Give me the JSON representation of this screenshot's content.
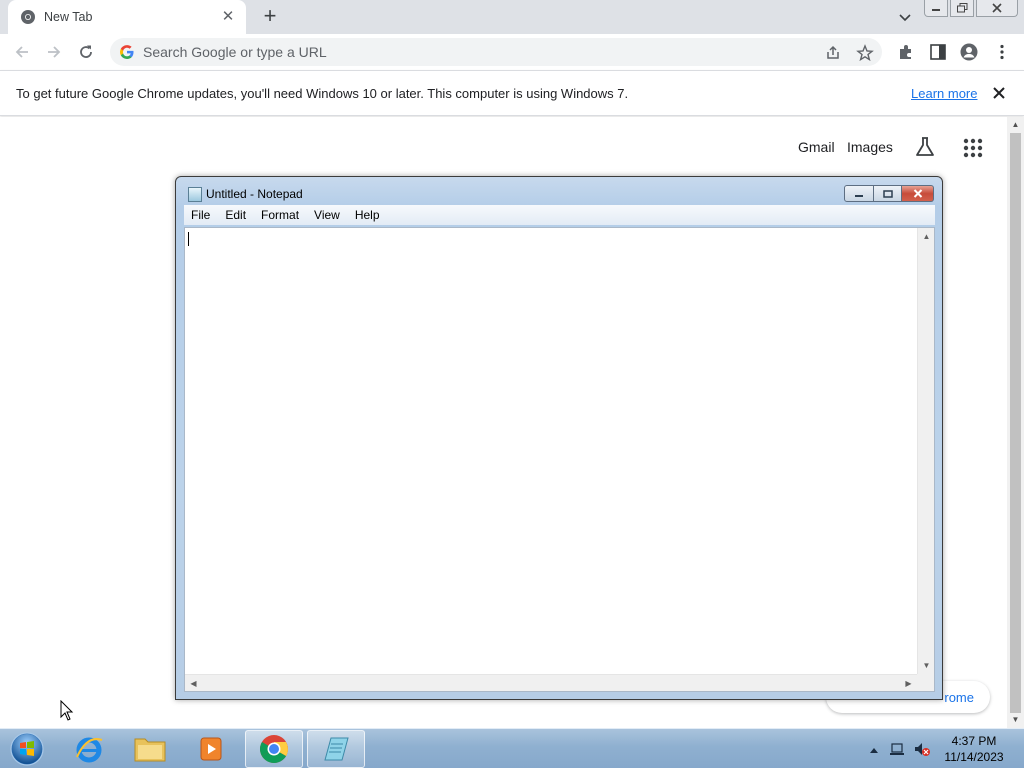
{
  "browser": {
    "tab_title": "New Tab",
    "omnibox_placeholder": "Search Google or type a URL",
    "infobar_message": "To get future Google Chrome updates, you'll need Windows 10 or later. This computer is using Windows 7.",
    "infobar_link": "Learn more"
  },
  "newtab_page": {
    "gmail_link": "Gmail",
    "images_link": "Images",
    "customize_label": "rome"
  },
  "notepad": {
    "title": "Untitled - Notepad",
    "menu": [
      "File",
      "Edit",
      "Format",
      "View",
      "Help"
    ],
    "content": ""
  },
  "taskbar": {
    "apps": [
      "internet-explorer-icon",
      "windows-explorer-icon",
      "media-player-icon",
      "chrome-icon",
      "notepad-icon"
    ],
    "time": "4:37 PM",
    "date": "11/14/2023"
  },
  "colors": {
    "link_blue": "#1a73e8",
    "tabstrip_bg": "#dee1e6",
    "taskbar_bg": "#8fb0d0"
  }
}
